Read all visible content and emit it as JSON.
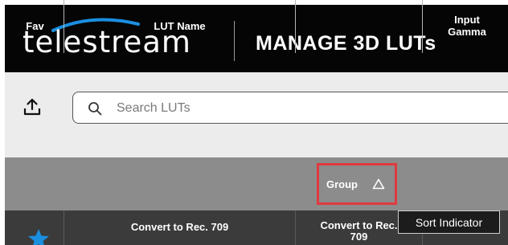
{
  "header": {
    "logo_text": "telestream",
    "title": "MANAGE 3D LUTs"
  },
  "toolbar": {
    "upload_icon": "upload-icon",
    "search": {
      "icon": "search-icon",
      "placeholder": "Search LUTs",
      "value": ""
    }
  },
  "table": {
    "columns": [
      "Fav",
      "LUT Name",
      "Group",
      "Input Gamma"
    ],
    "sort": {
      "column": "Group",
      "direction": "ascending",
      "icon": "sort-triangle-icon"
    },
    "rows": [
      {
        "fav": true,
        "fav_icon": "star-icon",
        "lut_name": "Convert to Rec. 709",
        "group": "Convert to Rec. 709",
        "input_gamma": ""
      }
    ]
  },
  "tooltip": {
    "text": "Sort Indicator"
  },
  "colors": {
    "header_bg": "#050505",
    "toolbar_bg": "#ececec",
    "table_header_bg": "#8c8c8c",
    "row_bg": "#3b3b3b",
    "accent_blue": "#1a8fe0",
    "highlight_red": "#e0393e"
  }
}
